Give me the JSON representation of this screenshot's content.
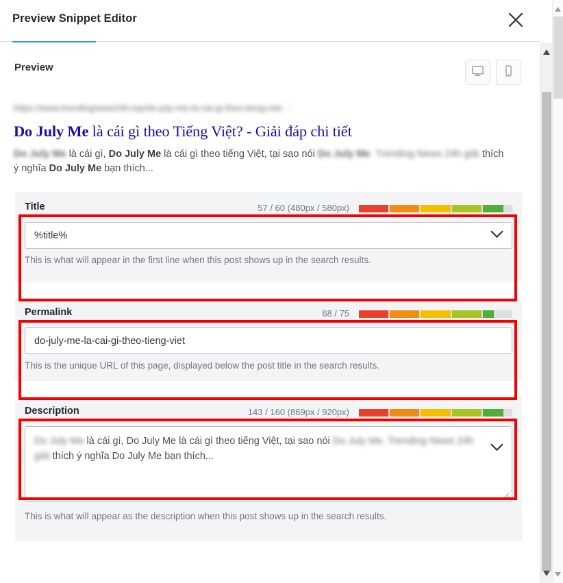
{
  "window": {
    "title": "Preview Snippet Editor",
    "close_icon": "close-icon"
  },
  "preview": {
    "section_label": "Preview",
    "device_toggle": [
      {
        "name": "desktop-view-button",
        "icon": "desktop-monitor-icon",
        "active": true
      },
      {
        "name": "mobile-view-button",
        "icon": "mobile-phone-icon",
        "active": false
      }
    ],
    "snippet": {
      "url": "https://www.trendingnews24h.top/do-july-me-la-cai-gi-theo-tieng-viet",
      "url_caret": "⋮",
      "title_bold": "Do July Me",
      "title_rest": " là cái gì theo Tiếng Việt? - Giải đáp chi tiết",
      "description_parts": [
        {
          "text": "Do July Me",
          "bold": true,
          "blurred": true
        },
        {
          "text": " là cái gì, ",
          "bold": false,
          "blurred": false
        },
        {
          "text": "Do July Me",
          "bold": true,
          "blurred": false
        },
        {
          "text": " là cái gì theo tiếng Việt, tại sao nói ",
          "bold": false,
          "blurred": false
        },
        {
          "text": "Do July Me",
          "bold": true,
          "blurred": true
        },
        {
          "text": ". Trending News 24h giải",
          "bold": false,
          "blurred": true
        },
        {
          "text": " thích ý nghĩa ",
          "bold": false,
          "blurred": false
        },
        {
          "text": "Do July Me",
          "bold": true,
          "blurred": false
        },
        {
          "text": " bạn thích...",
          "bold": false,
          "blurred": false
        }
      ]
    }
  },
  "fields": [
    {
      "key": "title",
      "label": "Title",
      "counter": "57 / 60 (480px / 580px)",
      "value": "%title%",
      "placeholder": "",
      "help": "This is what will appear in the first line when this post shows up in the search results.",
      "has_chevron": true,
      "progress": {
        "filled_ratio": 0.94,
        "segments": 5
      },
      "annotated": true
    },
    {
      "key": "permalink",
      "label": "Permalink",
      "counter": "68 / 75",
      "value": "do-july-me-la-cai-gi-theo-tieng-viet",
      "placeholder": "",
      "help": "This is the unique URL of this page, displayed below the post title in the search results.",
      "has_chevron": false,
      "progress": {
        "filled_ratio": 0.88,
        "segments": 5
      },
      "annotated": true
    },
    {
      "key": "description",
      "label": "Description",
      "counter": "143 / 160 (869px / 920px)",
      "value": "Do July Me là cái gì, Do July Me là cái gì theo tiếng Việt, tại sao nói Do July Me. Trending News 24h giải thích ý nghĩa Do July Me bạn thích...",
      "placeholder": "",
      "help": "This is what will appear as the description when this post shows up in the search results.",
      "has_chevron": true,
      "progress": {
        "filled_ratio": 0.94,
        "segments": 5
      },
      "annotated": true
    }
  ],
  "colors": {
    "accent_tab": "#1e9fd8",
    "annotation": "#f40000",
    "snippet_title_link": "#1a0dab",
    "card_bg": "#f3f4f5",
    "progress_segments": [
      "#e8402a",
      "#f08c14",
      "#f3c000",
      "#a8c422",
      "#4fae3a"
    ],
    "progress_track": "#dedede"
  }
}
